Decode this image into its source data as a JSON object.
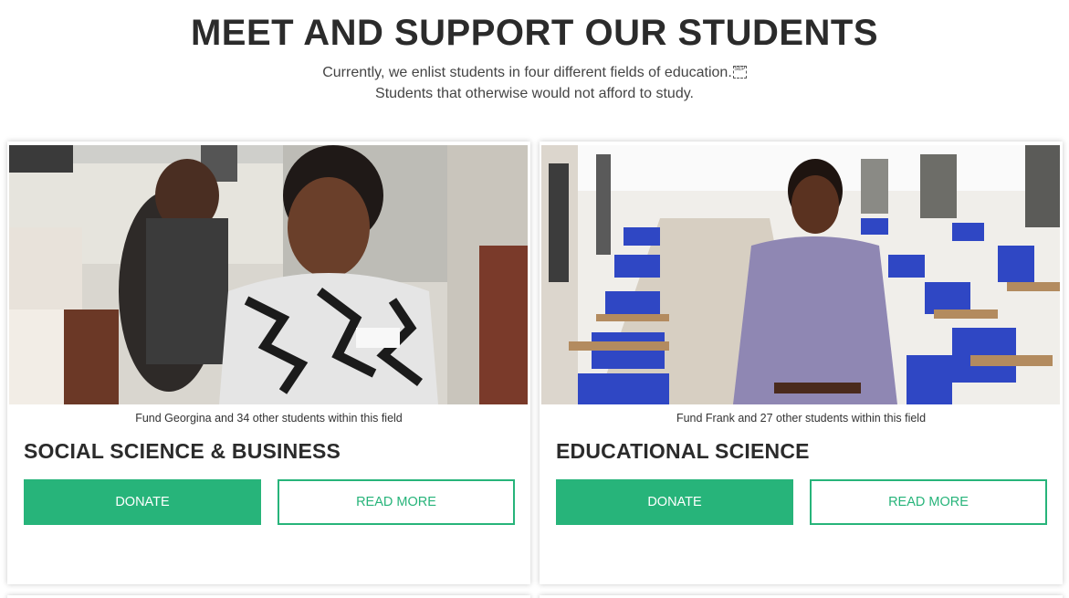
{
  "header": {
    "title": "MEET AND SUPPORT OUR STUDENTS",
    "subtitle_line1": "Currently, we enlist students in four different fields of education.",
    "subtitle_line2": "Students that otherwise would not afford to study.",
    "sep_glyph": "SEP"
  },
  "cards": [
    {
      "fund_text": "Fund Georgina and 34 other students within this field",
      "title": "SOCIAL SCIENCE & BUSINESS",
      "donate_label": "DONATE",
      "read_more_label": "READ MORE"
    },
    {
      "fund_text": "Fund Frank and 27 other students within this field",
      "title": "EDUCATIONAL SCIENCE",
      "donate_label": "DONATE",
      "read_more_label": "READ MORE"
    }
  ],
  "colors": {
    "accent": "#27b47a",
    "heading": "#2b2b2b"
  }
}
